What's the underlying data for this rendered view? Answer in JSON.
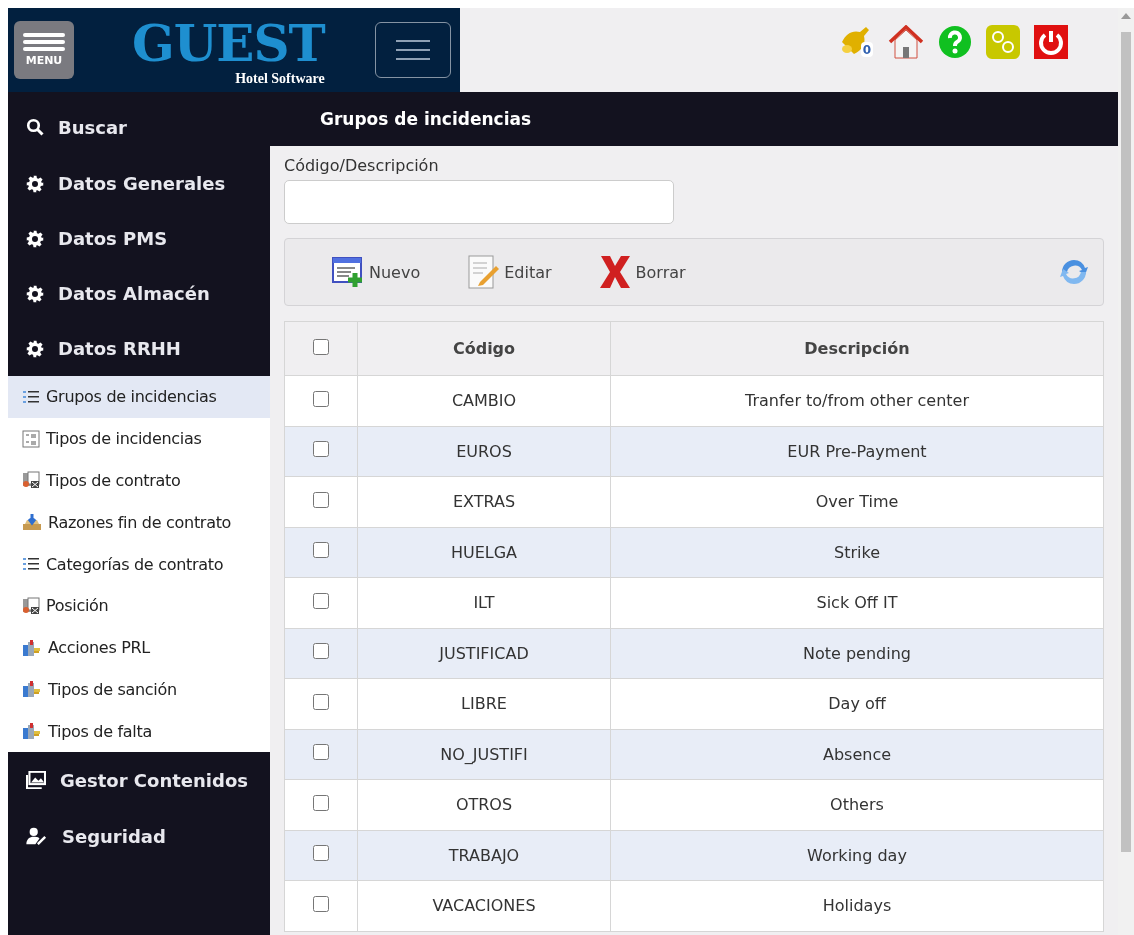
{
  "header": {
    "menu_label": "MENU",
    "logo_title": "GUEST",
    "logo_subtitle": "Hotel Software",
    "notification_count": "0"
  },
  "sidebar": {
    "items": [
      {
        "kind": "search",
        "label": "Buscar",
        "selected": false
      },
      {
        "kind": "section",
        "label": "Datos Generales",
        "selected": false
      },
      {
        "kind": "section",
        "label": "Datos PMS",
        "selected": false
      },
      {
        "kind": "section",
        "label": "Datos Almacén",
        "selected": false
      },
      {
        "kind": "section",
        "label": "Datos RRHH",
        "selected": false,
        "children": [
          {
            "label": "Grupos de incidencias",
            "selected": true
          },
          {
            "label": "Tipos de incidencias",
            "selected": false
          },
          {
            "label": "Tipos de contrato",
            "selected": false
          },
          {
            "label": "Razones fin de contrato",
            "selected": false
          },
          {
            "label": "Categorías de contrato",
            "selected": false
          },
          {
            "label": "Posición",
            "selected": false
          },
          {
            "label": "Acciones PRL",
            "selected": false
          },
          {
            "label": "Tipos de sanción",
            "selected": false
          },
          {
            "label": "Tipos de falta",
            "selected": false
          }
        ]
      },
      {
        "kind": "content",
        "label": "Gestor Contenidos",
        "selected": false
      },
      {
        "kind": "security",
        "label": "Seguridad",
        "selected": false
      }
    ]
  },
  "page_title": "Grupos de incidencias",
  "filter": {
    "label": "Código/Descripción"
  },
  "toolbar": {
    "buttons": [
      "Nuevo",
      "Editar",
      "Borrar"
    ]
  },
  "table": {
    "columns": [
      "Código",
      "Descripción"
    ],
    "select_all_checked": false,
    "rows": [
      {
        "code": "CAMBIO",
        "description": "Tranfer to/from other center",
        "checked": false
      },
      {
        "code": "EUROS",
        "description": "EUR Pre-Payment",
        "checked": false
      },
      {
        "code": "EXTRAS",
        "description": "Over Time",
        "checked": false
      },
      {
        "code": "HUELGA",
        "description": "Strike",
        "checked": false
      },
      {
        "code": "ILT",
        "description": "Sick Off IT",
        "checked": false
      },
      {
        "code": "JUSTIFICAD",
        "description": "Note pending",
        "checked": false
      },
      {
        "code": "LIBRE",
        "description": "Day off",
        "checked": false
      },
      {
        "code": "NO_JUSTIFI",
        "description": "Absence",
        "checked": false
      },
      {
        "code": "OTROS",
        "description": "Others",
        "checked": false
      },
      {
        "code": "TRABAJO",
        "description": "Working day",
        "checked": false
      },
      {
        "code": "VACACIONES",
        "description": "Holidays",
        "checked": false
      }
    ]
  }
}
